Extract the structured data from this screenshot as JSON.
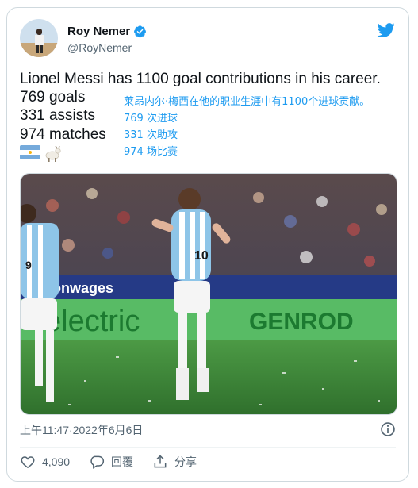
{
  "author": {
    "name": "Roy Nemer",
    "handle": "@RoyNemer"
  },
  "tweet": {
    "headline": "Lionel Messi has 1100 goal contributions in his career.",
    "stats": [
      "769 goals",
      "331 assists",
      "974 matches"
    ]
  },
  "translation": {
    "headline": "莱昂内尔·梅西在他的职业生涯中有1100个进球贡献。",
    "stats": [
      "769 次进球",
      "331 次助攻",
      "974 场比赛"
    ]
  },
  "media": {
    "ad_boards": [
      "conwages",
      "electric",
      "GENROD"
    ],
    "jersey_numbers": [
      "10",
      "9"
    ]
  },
  "meta": {
    "time": "上午11:47",
    "separator": " · ",
    "date": "2022年6月6日"
  },
  "actions": {
    "likes": "4,090",
    "reply_label": "回覆",
    "share_label": "分享"
  },
  "colors": {
    "accent": "#1d9bf0",
    "pitch": "#3f8a3a",
    "jersey_sky": "#8ec5e8"
  }
}
